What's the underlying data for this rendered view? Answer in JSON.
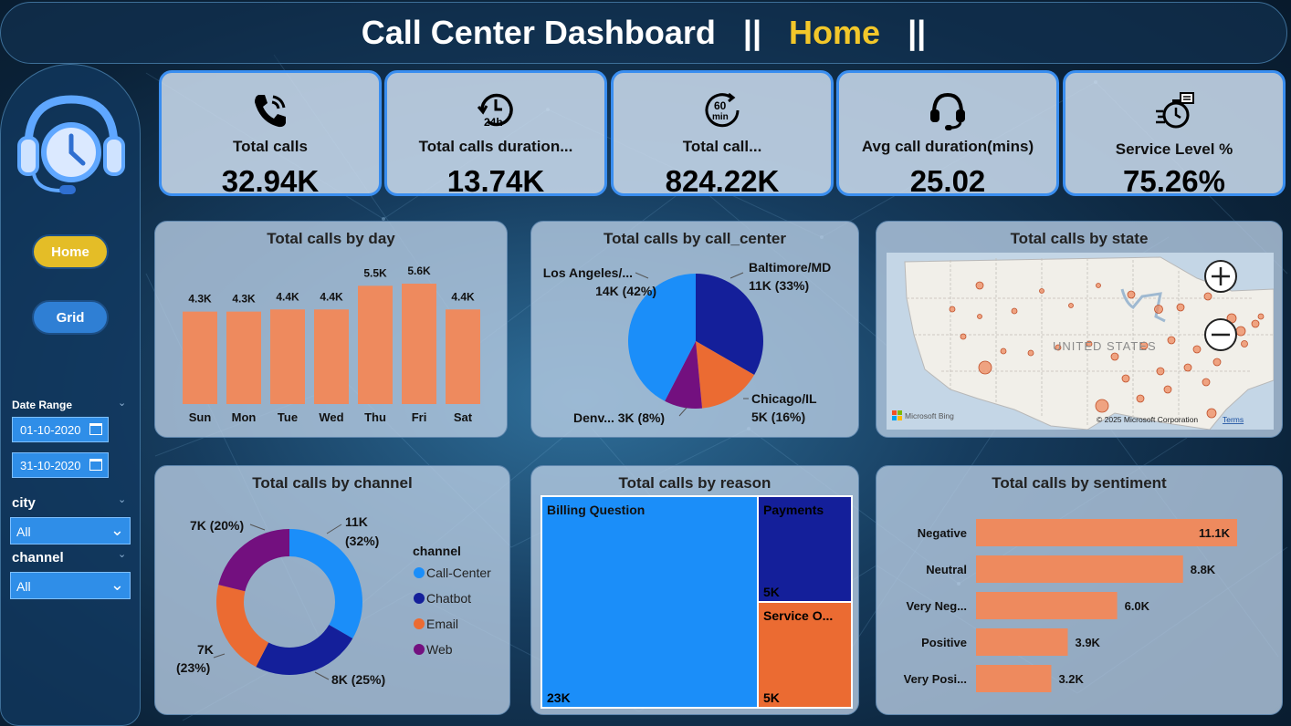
{
  "header": {
    "title": "Call Center Dashboard",
    "sep1": "||",
    "page": "Home",
    "sep2": "||"
  },
  "colors": {
    "accent": "#f2c72a",
    "bar": "#ee8a5e",
    "blue": "#1b8ef9",
    "navy": "#141f9a",
    "orange": "#eb6b32",
    "purple": "#73107f"
  },
  "nav": {
    "home": "Home",
    "grid": "Grid"
  },
  "filters": {
    "date_range_label": "Date Range",
    "date_start": "01-10-2020",
    "date_end": "31-10-2020",
    "city_label": "city",
    "city_value": "All",
    "channel_label": "channel",
    "channel_value": "All"
  },
  "kpis": [
    {
      "icon": "phone-icon",
      "label": "Total calls",
      "value": "32.94K"
    },
    {
      "icon": "clock-24h-icon",
      "label": "Total calls duration...",
      "value": "13.74K"
    },
    {
      "icon": "timer-60min-icon",
      "label": "Total call...",
      "value": "824.22K"
    },
    {
      "icon": "headset-icon",
      "label": "Avg call duration(mins)",
      "value": "25.02"
    },
    {
      "icon": "stopwatch-icon",
      "label": "Service Level %",
      "value": "75.26%"
    }
  ],
  "map": {
    "title": "Total calls by state",
    "country": "UNITED STATES",
    "bing": "Microsoft Bing",
    "copyright": "© 2025 Microsoft Corporation",
    "terms": "Terms"
  },
  "chart_data": [
    {
      "type": "bar",
      "title": "Total calls by day",
      "categories": [
        "Sun",
        "Mon",
        "Tue",
        "Wed",
        "Thu",
        "Fri",
        "Sat"
      ],
      "values": [
        4300,
        4300,
        4400,
        4400,
        5500,
        5600,
        4400
      ],
      "data_labels": [
        "4.3K",
        "4.3K",
        "4.4K",
        "4.4K",
        "5.5K",
        "5.6K",
        "4.4K"
      ]
    },
    {
      "type": "pie",
      "title": "Total calls by call_center",
      "slices": [
        {
          "name": "Baltimore/MD",
          "value": 11000,
          "percent": 33,
          "label": "11K (33%)",
          "color": "#141f9a"
        },
        {
          "name": "Chicago/IL",
          "value": 5000,
          "percent": 16,
          "label": "5K (16%)",
          "color": "#eb6b32"
        },
        {
          "name": "Denv...",
          "value": 3000,
          "percent": 8,
          "label": "3K (8%)",
          "color": "#73107f"
        },
        {
          "name": "Los Angeles/...",
          "value": 14000,
          "percent": 42,
          "label": "14K (42%)",
          "color": "#1b8ef9"
        }
      ]
    },
    {
      "type": "pie",
      "title": "Total calls by channel",
      "legend_title": "channel",
      "slices": [
        {
          "name": "Call-Center",
          "value": 11000,
          "percent": 32,
          "label1": "11K",
          "label2": "(32%)",
          "color": "#1b8ef9"
        },
        {
          "name": "Chatbot",
          "value": 8000,
          "percent": 25,
          "label1": "8K (25%)",
          "label2": "",
          "color": "#141f9a"
        },
        {
          "name": "Email",
          "value": 7000,
          "percent": 23,
          "label1": "7K",
          "label2": "(23%)",
          "color": "#eb6b32"
        },
        {
          "name": "Web",
          "value": 7000,
          "percent": 20,
          "label1": "7K (20%)",
          "label2": "",
          "color": "#73107f"
        }
      ]
    },
    {
      "type": "heatmap",
      "title": "Total calls by reason",
      "tiles": [
        {
          "name": "Billing Question",
          "value_label": "23K",
          "value": 23000,
          "color": "#1b8ef9"
        },
        {
          "name": "Payments",
          "value_label": "5K",
          "value": 5000,
          "color": "#141f9a"
        },
        {
          "name": "Service O...",
          "value_label": "5K",
          "value": 5000,
          "color": "#eb6b32"
        }
      ]
    },
    {
      "type": "bar",
      "orientation": "horizontal",
      "title": "Total calls by sentiment",
      "categories": [
        "Negative",
        "Neutral",
        "Very Neg...",
        "Positive",
        "Very Posi..."
      ],
      "values": [
        11100,
        8800,
        6000,
        3900,
        3200
      ],
      "data_labels": [
        "11.1K",
        "8.8K",
        "6.0K",
        "3.9K",
        "3.2K"
      ]
    }
  ]
}
